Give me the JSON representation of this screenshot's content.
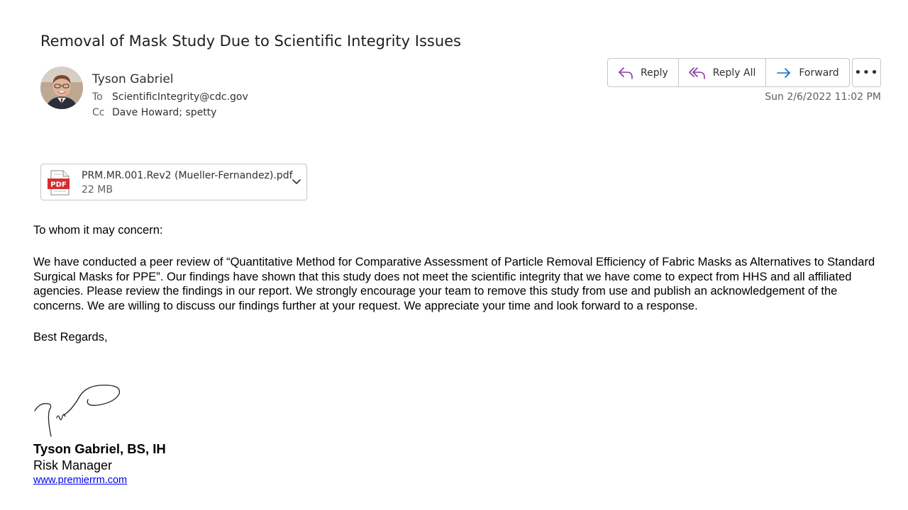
{
  "message": {
    "subject": "Removal of Mask Study Due to Scientific Integrity Issues",
    "sender": "Tyson Gabriel",
    "to_label": "To",
    "to": "ScientificIntegrity@cdc.gov",
    "cc_label": "Cc",
    "cc": "Dave Howard; spetty",
    "date": "Sun 2/6/2022 11:02 PM"
  },
  "actions": {
    "reply": "Reply",
    "reply_all": "Reply All",
    "forward": "Forward",
    "more": "•••"
  },
  "attachment": {
    "filename": "PRM.MR.001.Rev2 (Mueller-Fernandez).pdf",
    "size": "22 MB",
    "type_badge": "PDF"
  },
  "body": {
    "greeting": "To whom it may concern:",
    "paragraph": "We have conducted a peer review of “Quantitative Method for Comparative Assessment of Particle Removal Efficiency of Fabric Masks as Alternatives to Standard Surgical Masks for PPE”. Our findings have shown that this study does not meet the scientific integrity that we have come to expect from HHS and all affiliated agencies. Please review the findings in our report. We strongly encourage your team to remove this study from use and publish an acknowledgement of the concerns. We are willing to discuss our findings further at your request. We appreciate your time and look forward to a response.",
    "closing": "Best Regards,"
  },
  "signature": {
    "name": "Tyson Gabriel, BS, IH",
    "title": "Risk Manager",
    "link": "www.premierrm.com"
  },
  "colors": {
    "accent_purple": "#8a3aa8",
    "accent_blue": "#0f6cbd",
    "pdf_red": "#d32f2f",
    "link_blue": "#0000ee"
  }
}
